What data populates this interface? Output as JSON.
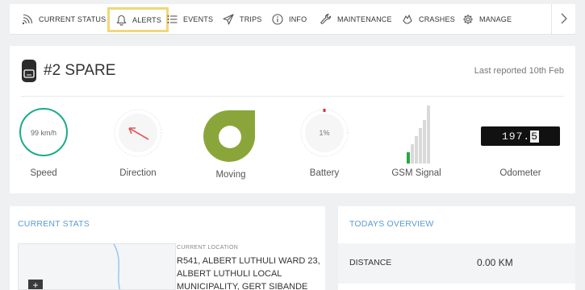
{
  "tabs": [
    {
      "label": "CURRENT STATUS",
      "icon": "wifi-signal-icon"
    },
    {
      "label": "ALERTS",
      "icon": "bell-icon",
      "active": true
    },
    {
      "label": "EVENTS",
      "icon": "list-icon"
    },
    {
      "label": "TRIPS",
      "icon": "paper-plane-icon"
    },
    {
      "label": "INFO",
      "icon": "info-icon"
    },
    {
      "label": "MAINTENANCE",
      "icon": "wrench-icon"
    },
    {
      "label": "CRASHES",
      "icon": "crash-icon"
    },
    {
      "label": "MANAGE",
      "icon": "gear-icon"
    }
  ],
  "next_icon": "chevron-right-icon",
  "vehicle": {
    "name": "#2 SPARE",
    "last_reported": "Last reported 10th Feb"
  },
  "gauges": {
    "speed": {
      "label": "Speed",
      "value": "99 km/h",
      "color": "#1aab8a"
    },
    "direction": {
      "label": "Direction",
      "arrow_color": "#e05a5a"
    },
    "moving": {
      "label": "Moving",
      "color": "#8aa63a"
    },
    "battery": {
      "label": "Battery",
      "value": "1%",
      "percent": 1,
      "indicator_color": "#e03030"
    },
    "gsm": {
      "label": "GSM Signal",
      "bars_filled": 1,
      "bars_total": 6,
      "active_color": "#27a845"
    },
    "odometer": {
      "label": "Odometer",
      "digits": [
        "1",
        "9",
        "7"
      ],
      "decimal": "5"
    }
  },
  "current_stats": {
    "title": "CURRENT STATS",
    "location_label": "CURRENT LOCATION",
    "location_text": "R541, ALBERT LUTHULI WARD 23, ALBERT LUTHULI LOCAL MUNICIPALITY, GERT SIBANDE",
    "zoom_label": "+"
  },
  "overview": {
    "title": "TODAYS OVERVIEW",
    "rows": [
      {
        "key": "DISTANCE",
        "value": "0.00 KM"
      }
    ]
  },
  "colors": {
    "accent_blue": "#5b9bd1",
    "active_tab_border": "#f2d679"
  }
}
